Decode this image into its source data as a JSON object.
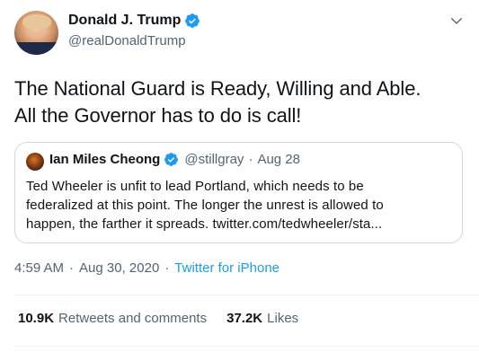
{
  "author": {
    "display_name": "Donald J. Trump",
    "handle": "@realDonaldTrump",
    "verified_icon": "verified-badge-icon"
  },
  "tweet": {
    "line1": "The National Guard is Ready, Willing and Able.",
    "line2": "All the Governor has to do is call!"
  },
  "quoted_tweet": {
    "display_name": "Ian Miles Cheong",
    "handle": "@stillgray",
    "separator": "·",
    "date": "Aug 28",
    "line1": "Ted Wheeler is unfit to lead Portland, which needs to be",
    "line2": "federalized at this point. The longer the unrest is allowed to",
    "line3": "happen, the farther it spreads. twitter.com/tedwheeler/sta..."
  },
  "meta": {
    "time": "4:59 AM",
    "separator": "·",
    "date": "Aug 30, 2020",
    "source": "Twitter for iPhone"
  },
  "stats": {
    "retweets_count": "10.9K",
    "retweets_label": "Retweets and comments",
    "likes_count": "37.2K",
    "likes_label": "Likes"
  },
  "colors": {
    "verified_blue": "#1d9bf0",
    "link_blue": "#1d9bf0",
    "secondary_text": "#536471",
    "border": "#cfd9de"
  }
}
